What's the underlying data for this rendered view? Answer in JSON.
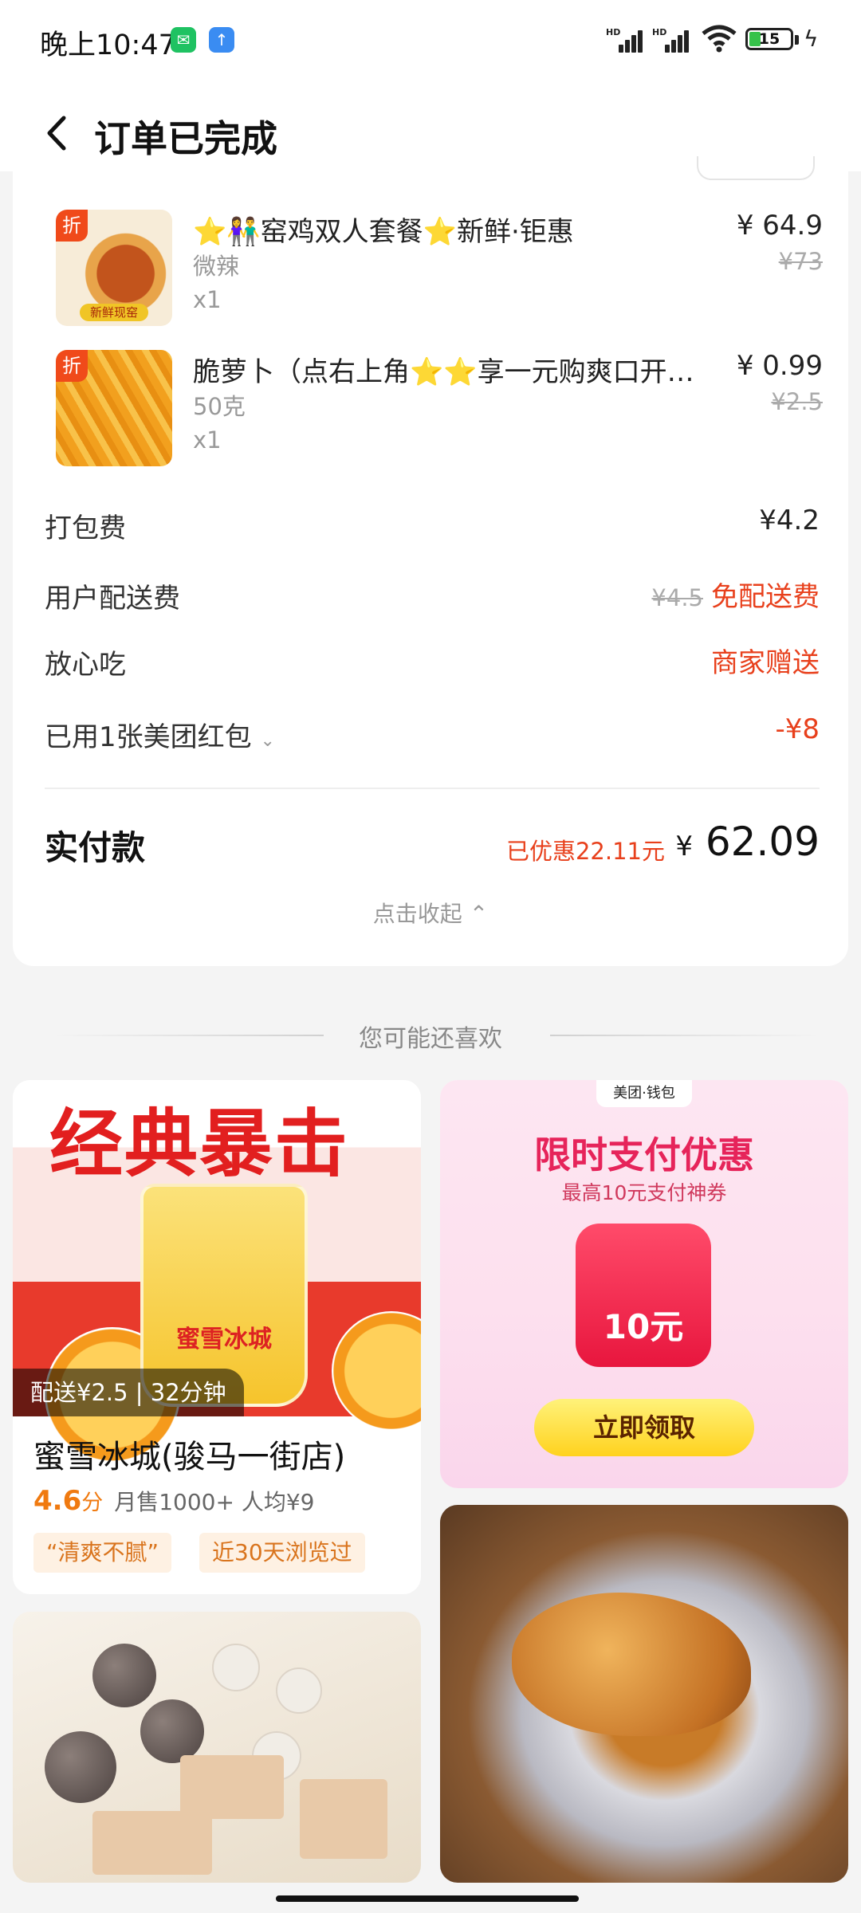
{
  "status": {
    "time": "晚上10:47",
    "battery": "15",
    "hd_label": "HD"
  },
  "header": {
    "title": "订单已完成"
  },
  "order": {
    "items": [
      {
        "name": "⭐👫窑鸡双人套餐⭐新鲜·钜惠",
        "spec": "微辣",
        "qty": "x1",
        "price": "¥ 64.9",
        "orig": "¥73",
        "badge": "折",
        "thumb_tag": "新鲜现窑"
      },
      {
        "name": "脆萝卜（点右上角⭐⭐享一元购爽口开胃菜",
        "spec": "50克",
        "qty": "x1",
        "price": "¥ 0.99",
        "orig": "¥2.5",
        "badge": "折"
      }
    ],
    "packing": {
      "label": "打包费",
      "value": "¥4.2"
    },
    "delivery_fee": {
      "label": "用户配送费",
      "orig": "¥4.5",
      "value": "免配送费"
    },
    "assurance": {
      "label": "放心吃",
      "value": "商家赠送"
    },
    "red_packet": {
      "label": "已用1张美团红包",
      "value": "-¥8"
    },
    "paid": {
      "label": "实付款",
      "saved": "已优惠22.11元",
      "yen": "¥",
      "total": "62.09"
    },
    "collapse": "点击收起"
  },
  "recommend": {
    "title": "您可能还喜欢",
    "shop": {
      "poster_headline": "经典暴击",
      "poster_brand": "蜜雪冰城",
      "delivery": "配送¥2.5 | 32分钟",
      "name": "蜜雪冰城(骏马一街店)",
      "score": "4.6",
      "score_unit": "分",
      "meta": "月售1000+  人均¥9",
      "tags": [
        "“清爽不腻”",
        "近30天浏览过"
      ]
    },
    "ad": {
      "logo": "美团·钱包",
      "headline": "限时支付优惠",
      "sub": "最高10元支付神券",
      "coupon": "10元",
      "button": "立即领取"
    }
  },
  "colors": {
    "accent_red": "#e8401c",
    "rating_orange": "#f07a10",
    "chip_bg": "#fef1e3"
  }
}
